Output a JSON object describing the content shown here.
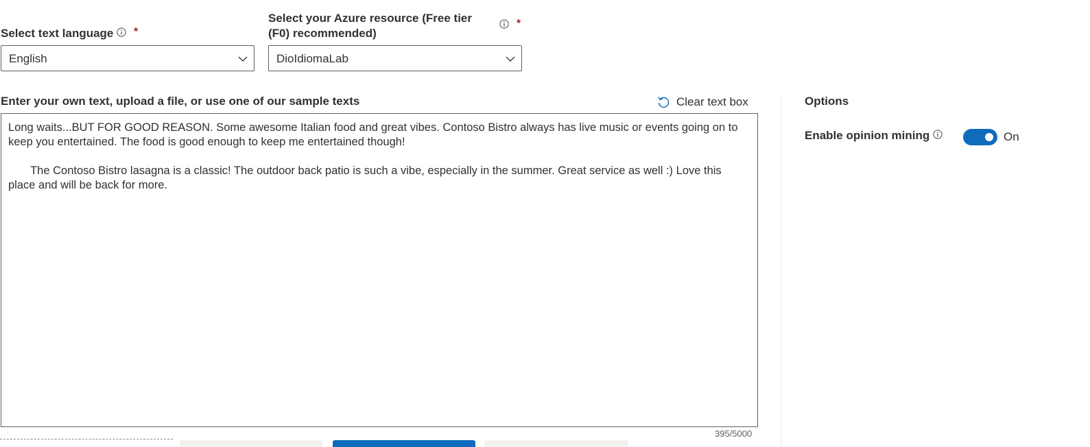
{
  "language": {
    "label": "Select text language",
    "required_marker": "*",
    "selected": "English"
  },
  "resource": {
    "label": "Select your Azure resource (Free tier (F0) recommended)",
    "required_marker": "*",
    "selected": "DioIdiomaLab"
  },
  "input": {
    "section_label": "Enter your own text, upload a file, or use one of our sample texts",
    "clear_label": "Clear text box",
    "text": "Long waits...BUT FOR GOOD REASON. Some awesome Italian food and great vibes. Contoso Bistro always has live music or events going on to keep you entertained. The food is good enough to keep me entertained though!\n\n       The Contoso Bistro lasagna is a classic! The outdoor back patio is such a vibe, especially in the summer. Great service as well :) Love this place and will be back for more.",
    "char_count": "395/5000"
  },
  "options": {
    "title": "Options",
    "opinion_mining_label": "Enable opinion mining",
    "opinion_mining_state": "On"
  },
  "colors": {
    "accent": "#0f6cbd",
    "required": "#a4262c",
    "border": "#605e5c",
    "text": "#323130"
  },
  "icons": {
    "info": "info-icon",
    "chevron": "chevron-down-icon",
    "undo": "undo-icon"
  }
}
